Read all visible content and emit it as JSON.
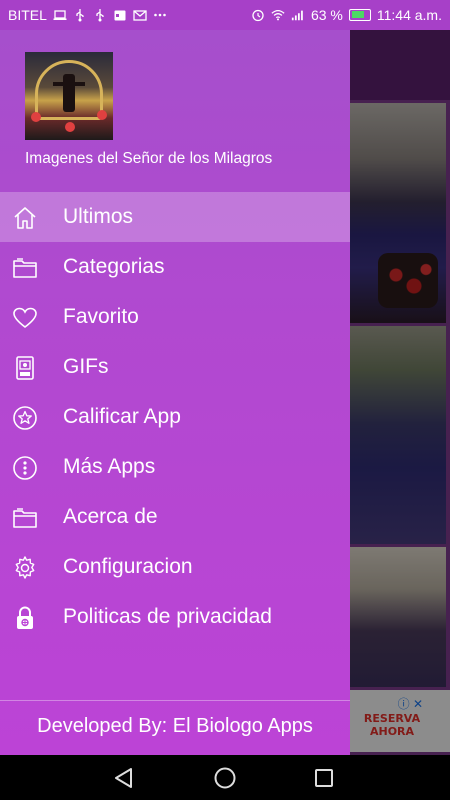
{
  "status_bar": {
    "carrier": "BITEL",
    "battery_percent": "63 %",
    "time": "11:44 a.m."
  },
  "drawer": {
    "app_name": "Imagenes del Señor de los Milagros",
    "menu": [
      {
        "label": "Ultimos",
        "icon": "home-icon",
        "active": true
      },
      {
        "label": "Categorias",
        "icon": "folder-icon",
        "active": false
      },
      {
        "label": "Favorito",
        "icon": "heart-icon",
        "active": false
      },
      {
        "label": "GIFs",
        "icon": "gif-file-icon",
        "active": false
      },
      {
        "label": "Calificar App",
        "icon": "star-icon",
        "active": false
      },
      {
        "label": "Más Apps",
        "icon": "more-vertical-icon",
        "active": false
      },
      {
        "label": "Acerca de",
        "icon": "folder-icon",
        "active": false
      },
      {
        "label": "Configuracion",
        "icon": "gear-icon",
        "active": false
      },
      {
        "label": "Politicas de privacidad",
        "icon": "lock-icon",
        "active": false
      }
    ],
    "footer": "Developed By: El Biologo Apps"
  },
  "background_ad": {
    "text": "RESERVA AHORA"
  },
  "colors": {
    "drawer_top": "#a64fcc",
    "drawer_bottom": "#bc43d6",
    "status_bar": "#a740c8",
    "active_item_overlay": "rgba(255,255,255,0.25)"
  }
}
